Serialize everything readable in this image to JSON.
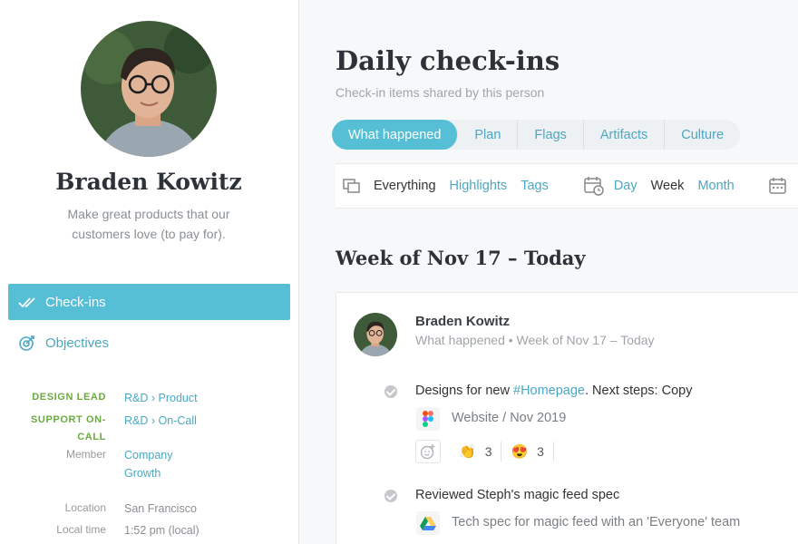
{
  "profile": {
    "name": "Braden Kowitz",
    "bio": "Make great products that our customers love (to pay for)."
  },
  "nav": [
    {
      "label": "Check-ins",
      "icon": "double-check-icon",
      "active": true
    },
    {
      "label": "Objectives",
      "icon": "target-icon",
      "active": false
    }
  ],
  "meta": {
    "design_lead_label": "DESIGN LEAD",
    "design_lead_value": "R&D › Product",
    "support_label_1": "SUPPORT ON-",
    "support_label_2": "CALL",
    "support_value": "R&D › On-Call",
    "member_label": "Member",
    "member_value_1": "Company",
    "member_value_2": "Growth",
    "location_label": "Location",
    "location_value": "San Francisco",
    "localtime_label": "Local time",
    "localtime_value": "1:52 pm (local)"
  },
  "page": {
    "title": "Daily check-ins",
    "subtitle": "Check-in items shared by this person"
  },
  "tabs": [
    {
      "label": "What happened",
      "active": true
    },
    {
      "label": "Plan",
      "active": false
    },
    {
      "label": "Flags",
      "active": false
    },
    {
      "label": "Artifacts",
      "active": false
    },
    {
      "label": "Culture",
      "active": false
    }
  ],
  "filters": {
    "everything": "Everything",
    "highlights": "Highlights",
    "tags": "Tags",
    "day": "Day",
    "week": "Week",
    "month": "Month"
  },
  "week_title": "Week of Nov 17 – Today",
  "card": {
    "author": "Braden Kowitz",
    "subtitle": "What happened • Week of Nov 17 – Today",
    "item1_prefix": "Designs for new ",
    "item1_tag": "#Homepage",
    "item1_suffix": ". Next steps: Copy",
    "item1_attachment": "Website / Nov 2019",
    "reaction1_emoji": "👏",
    "reaction1_count": "3",
    "reaction2_emoji": "😍",
    "reaction2_count": "3",
    "item2_text": "Reviewed Steph's magic feed spec",
    "item2_attachment": "Tech spec for magic feed with an 'Everyone' team"
  },
  "colors": {
    "accent": "#56bfd5",
    "link": "#4aa8c4",
    "role": "#6aab3e"
  }
}
